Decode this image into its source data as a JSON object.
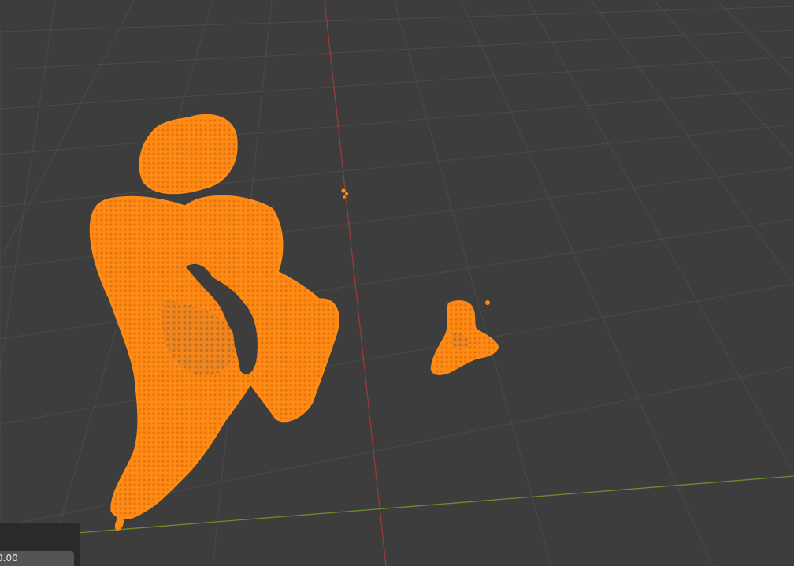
{
  "viewport": {
    "background": "#3d3d3d",
    "grid_color": "#4a4a4a",
    "x_axis_color": "#6b8e2e",
    "y_axis_color": "#9b3a3a",
    "selection_color": "#ff8000"
  },
  "operator_panel": {
    "value": "0.00"
  }
}
